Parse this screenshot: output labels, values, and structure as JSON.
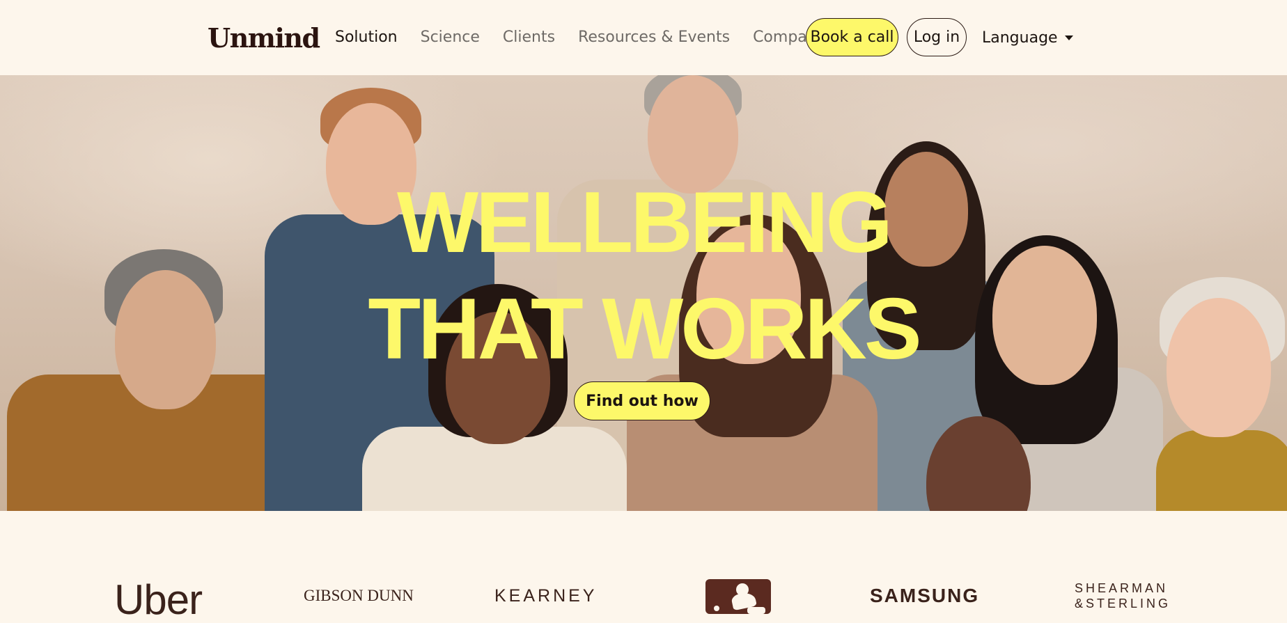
{
  "header": {
    "logo": "Unmind",
    "nav": [
      {
        "label": "Solution"
      },
      {
        "label": "Science"
      },
      {
        "label": "Clients"
      },
      {
        "label": "Resources & Events"
      },
      {
        "label": "Company"
      }
    ],
    "book_call": "Book a call",
    "login": "Log in",
    "language": "Language"
  },
  "hero": {
    "title_line1": "WELLBEING",
    "title_line2": "THAT WORKS",
    "cta": "Find out how"
  },
  "clients": {
    "uber": "Uber",
    "gibson_dunn": "GIBSON DUNN",
    "kearney": "KEARNEY",
    "samsung": "SAMSUNG",
    "shearman_line1": "SHEARMAN",
    "shearman_line2": "&STERLING"
  },
  "colors": {
    "accent_yellow": "#fdf86a",
    "brand_dark": "#2b1410",
    "background": "#fdf6ec"
  }
}
